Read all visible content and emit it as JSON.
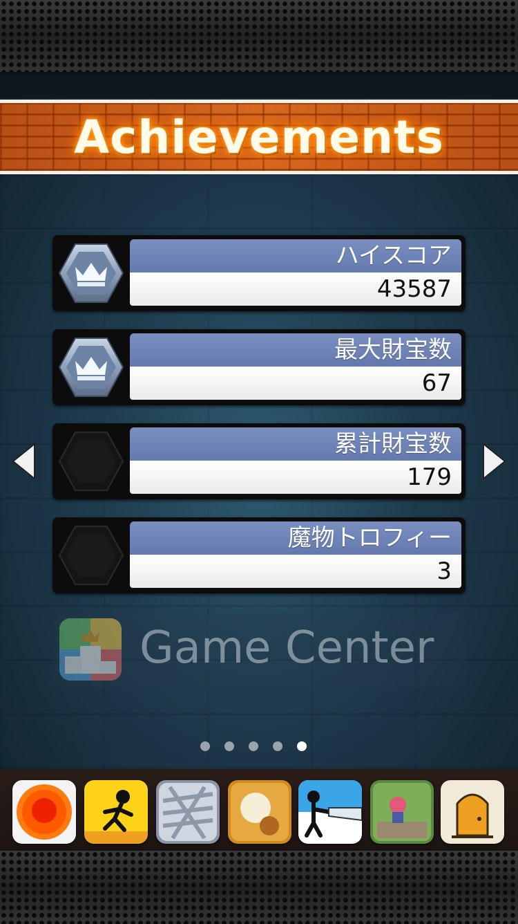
{
  "header": {
    "title": "Achievements"
  },
  "achievements": [
    {
      "label": "ハイスコア",
      "value": "43587",
      "badge": "crown-badge-icon",
      "unlocked": true
    },
    {
      "label": "最大財宝数",
      "value": "67",
      "badge": "crown-badge-icon",
      "unlocked": true
    },
    {
      "label": "累計財宝数",
      "value": "179",
      "badge": "locked-badge-icon",
      "unlocked": false
    },
    {
      "label": "魔物トロフィー",
      "value": "3",
      "badge": "locked-badge-icon",
      "unlocked": false
    }
  ],
  "game_center": {
    "label": "Game Center",
    "icon": "game-center-podium-icon"
  },
  "pagination": {
    "total": 5,
    "active_index": 4
  },
  "nav": {
    "prev_icon": "left-arrow-icon",
    "next_icon": "right-arrow-icon"
  },
  "app_bar": {
    "apps": [
      "red-button-app-icon",
      "stickman-run-app-icon",
      "mummy-app-icon",
      "dinosaur-app-icon",
      "stickman-saw-app-icon",
      "pixel-girl-app-icon",
      "door-app-icon"
    ]
  },
  "colors": {
    "banner": "#c0571a",
    "label_bar": "#6b80b4",
    "value_bar": "#ffffff",
    "stage": "#1e3b4d"
  }
}
